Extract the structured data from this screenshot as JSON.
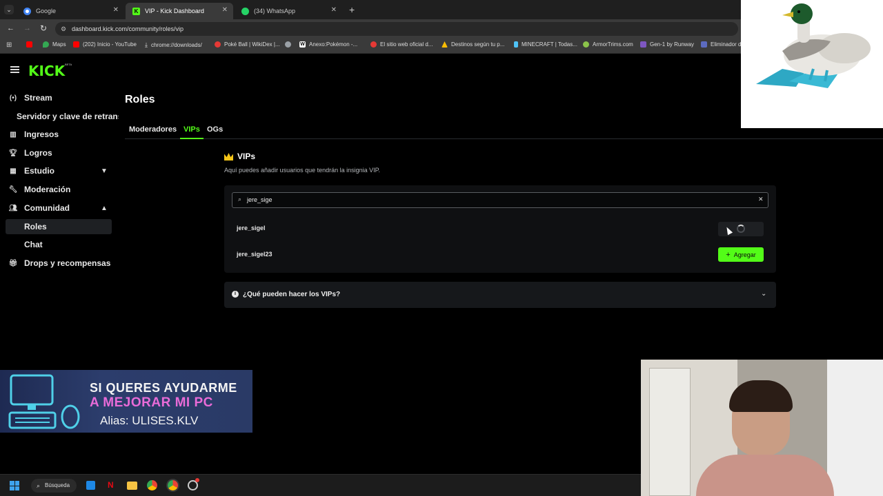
{
  "browser": {
    "tabs": [
      {
        "title": "Google",
        "favicon": "google-icon",
        "color": "#4285f4"
      },
      {
        "title": "VIP - Kick Dashboard",
        "favicon": "kick-icon",
        "color": "#53fc18",
        "active": true
      },
      {
        "title": "(34) WhatsApp",
        "favicon": "whatsapp-icon",
        "color": "#25d366"
      }
    ],
    "url": "dashboard.kick.com/community/roles/vip",
    "bookmarks": [
      {
        "label": "",
        "color": "#ff0000"
      },
      {
        "label": "Maps",
        "color": "#34a853"
      },
      {
        "label": "(202) Inicio - YouTube",
        "color": "#ff0000"
      },
      {
        "label": "chrome://downloads/",
        "color": "#9aa0a6"
      },
      {
        "label": "Poké Ball | WikiDex |...",
        "color": "#e53935"
      },
      {
        "label": "",
        "color": "#9aa0a6"
      },
      {
        "label": "Anexo:Pokémon -...",
        "color": "#ffffff"
      },
      {
        "label": "El sitio web oficial d...",
        "color": "#e53935"
      },
      {
        "label": "Destinos según tu p...",
        "color": "#fbbc04"
      },
      {
        "label": "MINECRAFT | Todas...",
        "color": "#4fc3f7"
      },
      {
        "label": "ArmorTrims.com",
        "color": "#8bc34a"
      },
      {
        "label": "Gen-1 by Runway",
        "color": "#7e57c2"
      },
      {
        "label": "Eliminador d",
        "color": "#5c6bc0"
      }
    ]
  },
  "brand": {
    "logo": "KICK",
    "badge": "BETA",
    "accent": "#53fc18"
  },
  "sidebar": {
    "items": [
      {
        "label": "Stream",
        "icon": "stream-icon"
      },
      {
        "label": "Servidor y clave de retransmisión",
        "icon": ""
      },
      {
        "label": "Ingresos",
        "icon": "chart-icon"
      },
      {
        "label": "Logros",
        "icon": "trophy-icon"
      },
      {
        "label": "Estudio",
        "icon": "film-icon"
      },
      {
        "label": "Moderación",
        "icon": "wrench-icon"
      },
      {
        "label": "Comunidad",
        "icon": "people-icon"
      },
      {
        "label": "Roles",
        "icon": ""
      },
      {
        "label": "Chat",
        "icon": ""
      },
      {
        "label": "Drops y recompensas",
        "icon": "gift-icon"
      }
    ]
  },
  "main": {
    "title": "Roles",
    "tabs": [
      "Moderadores",
      "VIPs",
      "OGs"
    ],
    "active_tab": "VIPs",
    "section_title": "VIPs",
    "section_desc": "Aquí puedes añadir usuarios que tendrán la insignia VIP.",
    "search_value": "jere_sige",
    "results": [
      {
        "username": "jere_sigel",
        "state": "loading"
      },
      {
        "username": "jere_sigel23",
        "state": "add"
      }
    ],
    "add_label": "Agregar",
    "faq_label": "¿Qué pueden hacer los VIPs?"
  },
  "banner": {
    "line1": "SI QUERES AYUDARME",
    "line2": "A MEJORAR MI PC",
    "line3": "Alias: ULISES.KLV"
  },
  "taskbar": {
    "search_label": "Búsqueda"
  }
}
